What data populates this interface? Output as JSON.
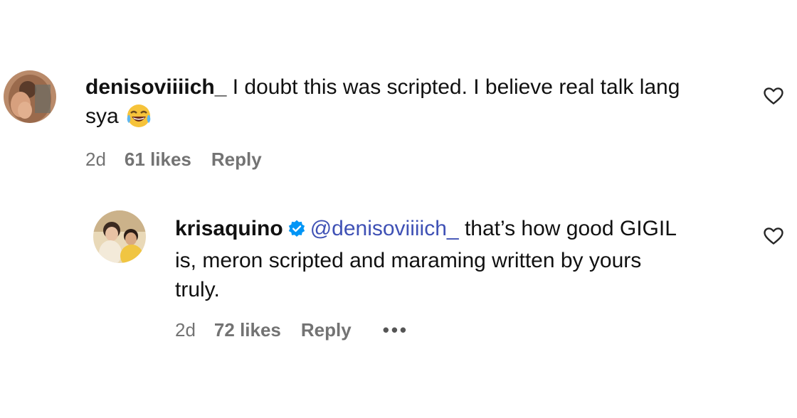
{
  "comments": [
    {
      "username": "denisoviiiich_",
      "text_line1": "I doubt this was scripted. I believe real talk lang",
      "text_line2": "sya",
      "emoji": "face-with-tears-of-joy",
      "time": "2d",
      "likes": "61 likes",
      "reply": "Reply"
    },
    {
      "username": "krisaquino",
      "verified": true,
      "mention": "@denisoviiiich_",
      "text_line1": "that’s how good GIGIL",
      "text_line2": "is, meron scripted and maraming written by yours",
      "text_line3": "truly.",
      "time": "2d",
      "likes": "72 likes",
      "reply": "Reply",
      "more": "•••"
    }
  ],
  "icons": {
    "like": "heart-outline-icon",
    "verified": "verified-badge-icon",
    "more": "more-options-icon"
  },
  "colors": {
    "mention": "#3f51b5",
    "verified": "#0095f6",
    "meta_text": "#737373"
  }
}
